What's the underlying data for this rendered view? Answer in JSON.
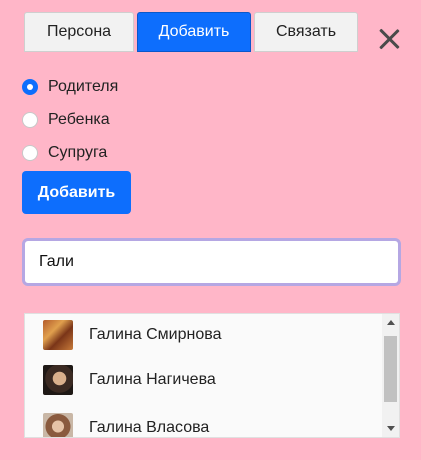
{
  "tabs": [
    {
      "label": "Персона",
      "active": false
    },
    {
      "label": "Добавить",
      "active": true
    },
    {
      "label": "Связать",
      "active": false
    }
  ],
  "close_icon": "close-icon",
  "relation_options": [
    {
      "label": "Родителя",
      "checked": true
    },
    {
      "label": "Ребенка",
      "checked": false
    },
    {
      "label": "Супруга",
      "checked": false
    }
  ],
  "add_button_label": "Добавить",
  "search": {
    "value": "Гали",
    "placeholder": ""
  },
  "results": [
    {
      "name": "Галина Смирнова"
    },
    {
      "name": "Галина Нагичева"
    },
    {
      "name": "Галина Власова"
    }
  ],
  "colors": {
    "background": "#ffb6c8",
    "accent": "#0d6efd",
    "input_focus_border": "#b5a7e3"
  }
}
